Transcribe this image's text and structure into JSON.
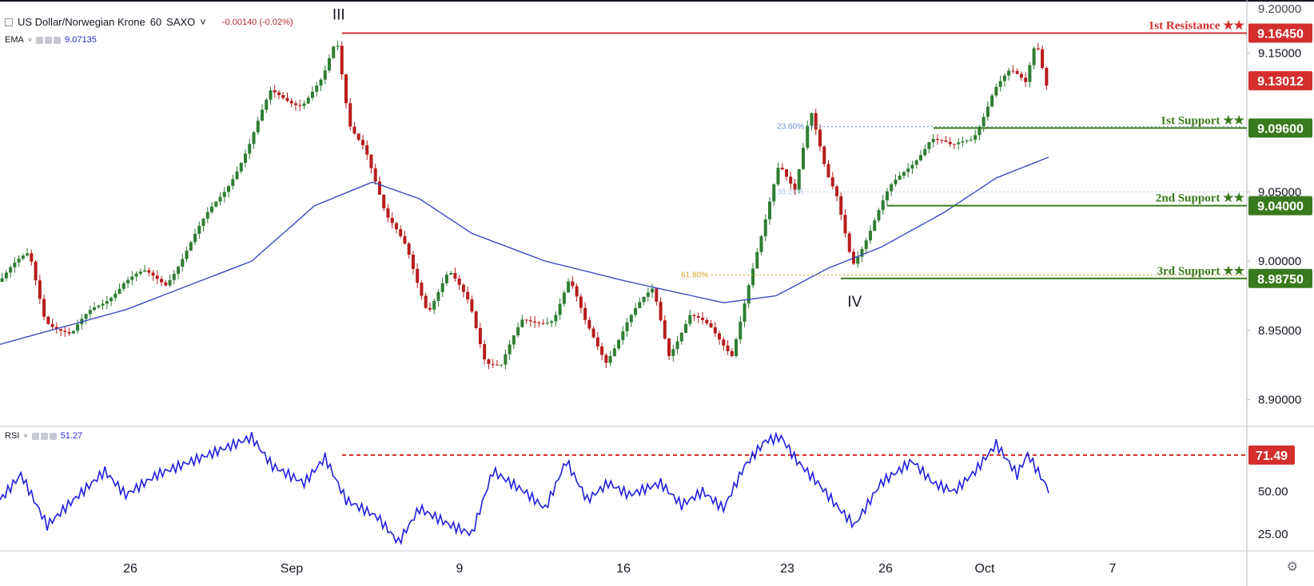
{
  "header": {
    "symbol": "US Dollar/Norwegian Krone",
    "interval": "60",
    "exchange": "SAXO",
    "change": "-0.00140 (-0.02%)"
  },
  "indicators": {
    "ema": {
      "name": "EMA",
      "value": "9.07135"
    },
    "rsi": {
      "name": "RSI",
      "value": "51.27"
    }
  },
  "colors": {
    "up": "#2e7d32",
    "down": "#b71c1c",
    "ema_line": "#3a4bc2",
    "rsi_line": "#1f1fe0",
    "resistance": "#d32f2f",
    "support": "#3a7a1e",
    "last_price": "#d32f2f"
  },
  "chart_data": {
    "type": "candlestick",
    "main": {
      "ylim": [
        8.882,
        9.178
      ],
      "y_ticks": [
        "8.90000",
        "8.95000",
        "9.00000",
        "9.05000",
        "9.15000"
      ],
      "x_ticks": [
        "26",
        "Sep",
        "9",
        "16",
        "23",
        "26",
        "Oct",
        "7"
      ],
      "price_path": [
        {
          "t": 0,
          "p": 8.985
        },
        {
          "t": 0.03,
          "p": 9.005
        },
        {
          "t": 0.045,
          "p": 8.96
        },
        {
          "t": 0.07,
          "p": 8.945
        },
        {
          "t": 0.09,
          "p": 8.965
        },
        {
          "t": 0.12,
          "p": 8.985
        },
        {
          "t": 0.14,
          "p": 8.99
        },
        {
          "t": 0.16,
          "p": 8.985
        },
        {
          "t": 0.19,
          "p": 9.02
        },
        {
          "t": 0.215,
          "p": 9.05
        },
        {
          "t": 0.24,
          "p": 9.085
        },
        {
          "t": 0.26,
          "p": 9.12
        },
        {
          "t": 0.29,
          "p": 9.115
        },
        {
          "t": 0.31,
          "p": 9.13
        },
        {
          "t": 0.323,
          "p": 9.158
        },
        {
          "t": 0.335,
          "p": 9.1
        },
        {
          "t": 0.35,
          "p": 9.085
        },
        {
          "t": 0.37,
          "p": 9.03
        },
        {
          "t": 0.39,
          "p": 9.01
        },
        {
          "t": 0.41,
          "p": 8.965
        },
        {
          "t": 0.43,
          "p": 8.99
        },
        {
          "t": 0.45,
          "p": 8.97
        },
        {
          "t": 0.465,
          "p": 8.93
        },
        {
          "t": 0.48,
          "p": 8.925
        },
        {
          "t": 0.5,
          "p": 8.955
        },
        {
          "t": 0.53,
          "p": 8.96
        },
        {
          "t": 0.545,
          "p": 8.985
        },
        {
          "t": 0.56,
          "p": 8.955
        },
        {
          "t": 0.58,
          "p": 8.93
        },
        {
          "t": 0.6,
          "p": 8.955
        },
        {
          "t": 0.625,
          "p": 8.98
        },
        {
          "t": 0.64,
          "p": 8.935
        },
        {
          "t": 0.66,
          "p": 8.96
        },
        {
          "t": 0.68,
          "p": 8.95
        },
        {
          "t": 0.7,
          "p": 8.935
        },
        {
          "t": 0.715,
          "p": 8.98
        },
        {
          "t": 0.73,
          "p": 9.02
        },
        {
          "t": 0.745,
          "p": 9.07
        },
        {
          "t": 0.76,
          "p": 9.055
        },
        {
          "t": 0.775,
          "p": 9.11
        },
        {
          "t": 0.79,
          "p": 9.06
        },
        {
          "t": 0.8,
          "p": 9.045
        },
        {
          "t": 0.815,
          "p": 9.0
        },
        {
          "t": 0.83,
          "p": 9.02
        },
        {
          "t": 0.85,
          "p": 9.05
        },
        {
          "t": 0.87,
          "p": 9.07
        },
        {
          "t": 0.89,
          "p": 9.09
        },
        {
          "t": 0.91,
          "p": 9.08
        },
        {
          "t": 0.93,
          "p": 9.09
        },
        {
          "t": 0.95,
          "p": 9.125
        },
        {
          "t": 0.965,
          "p": 9.135
        },
        {
          "t": 0.98,
          "p": 9.128
        },
        {
          "t": 0.99,
          "p": 9.162
        },
        {
          "t": 1.0,
          "p": 9.13
        }
      ],
      "ema_path": [
        {
          "t": 0,
          "p": 8.94
        },
        {
          "t": 0.12,
          "p": 8.965
        },
        {
          "t": 0.24,
          "p": 9.0
        },
        {
          "t": 0.3,
          "p": 9.04
        },
        {
          "t": 0.355,
          "p": 9.057
        },
        {
          "t": 0.4,
          "p": 9.045
        },
        {
          "t": 0.45,
          "p": 9.02
        },
        {
          "t": 0.52,
          "p": 9.0
        },
        {
          "t": 0.6,
          "p": 8.985
        },
        {
          "t": 0.69,
          "p": 8.97
        },
        {
          "t": 0.74,
          "p": 8.975
        },
        {
          "t": 0.79,
          "p": 8.995
        },
        {
          "t": 0.84,
          "p": 9.01
        },
        {
          "t": 0.9,
          "p": 9.035
        },
        {
          "t": 0.95,
          "p": 9.06
        },
        {
          "t": 1.0,
          "p": 9.075
        }
      ],
      "levels": [
        {
          "label": "1st Resistance ★★",
          "value": "9.16450",
          "price": 9.1645,
          "kind": "resistance"
        },
        {
          "label": "1st Support ★★",
          "value": "9.09600",
          "price": 9.096,
          "kind": "support"
        },
        {
          "label": "2nd Support ★★",
          "value": "9.04000",
          "price": 9.04,
          "kind": "support"
        },
        {
          "label": "3rd Support ★★",
          "value": "8.98750",
          "price": 8.9875,
          "kind": "support"
        }
      ],
      "last_price": {
        "value": "9.13012",
        "price": 9.13012
      },
      "fib_levels": [
        {
          "label": "23.60%",
          "price": 9.097
        },
        {
          "label": "38.20%",
          "price": 9.05
        },
        {
          "label": "61.80%",
          "price": 8.99
        }
      ],
      "wave_labels": [
        {
          "label": "III",
          "t": 0.323,
          "price": 9.172
        },
        {
          "label": "IV",
          "t": 0.815,
          "price": 8.965
        }
      ]
    },
    "rsi": {
      "ylim": [
        15,
        88
      ],
      "y_ticks": [
        "25.00",
        "50.00"
      ],
      "marker": {
        "value": "71.49",
        "level": 71.49
      },
      "path": [
        {
          "t": 0,
          "p": 45
        },
        {
          "t": 0.02,
          "p": 60
        },
        {
          "t": 0.045,
          "p": 30
        },
        {
          "t": 0.07,
          "p": 45
        },
        {
          "t": 0.1,
          "p": 62
        },
        {
          "t": 0.12,
          "p": 48
        },
        {
          "t": 0.15,
          "p": 60
        },
        {
          "t": 0.2,
          "p": 72
        },
        {
          "t": 0.24,
          "p": 82
        },
        {
          "t": 0.26,
          "p": 65
        },
        {
          "t": 0.29,
          "p": 55
        },
        {
          "t": 0.31,
          "p": 70
        },
        {
          "t": 0.33,
          "p": 45
        },
        {
          "t": 0.36,
          "p": 35
        },
        {
          "t": 0.38,
          "p": 20
        },
        {
          "t": 0.4,
          "p": 40
        },
        {
          "t": 0.43,
          "p": 30
        },
        {
          "t": 0.45,
          "p": 25
        },
        {
          "t": 0.47,
          "p": 62
        },
        {
          "t": 0.5,
          "p": 50
        },
        {
          "t": 0.52,
          "p": 40
        },
        {
          "t": 0.54,
          "p": 68
        },
        {
          "t": 0.56,
          "p": 45
        },
        {
          "t": 0.58,
          "p": 55
        },
        {
          "t": 0.6,
          "p": 48
        },
        {
          "t": 0.63,
          "p": 55
        },
        {
          "t": 0.65,
          "p": 42
        },
        {
          "t": 0.67,
          "p": 50
        },
        {
          "t": 0.69,
          "p": 40
        },
        {
          "t": 0.71,
          "p": 65
        },
        {
          "t": 0.73,
          "p": 80
        },
        {
          "t": 0.745,
          "p": 82
        },
        {
          "t": 0.76,
          "p": 68
        },
        {
          "t": 0.78,
          "p": 55
        },
        {
          "t": 0.8,
          "p": 40
        },
        {
          "t": 0.815,
          "p": 30
        },
        {
          "t": 0.84,
          "p": 55
        },
        {
          "t": 0.87,
          "p": 68
        },
        {
          "t": 0.89,
          "p": 55
        },
        {
          "t": 0.91,
          "p": 50
        },
        {
          "t": 0.93,
          "p": 62
        },
        {
          "t": 0.95,
          "p": 78
        },
        {
          "t": 0.97,
          "p": 60
        },
        {
          "t": 0.98,
          "p": 72
        },
        {
          "t": 1.0,
          "p": 51
        }
      ]
    }
  }
}
